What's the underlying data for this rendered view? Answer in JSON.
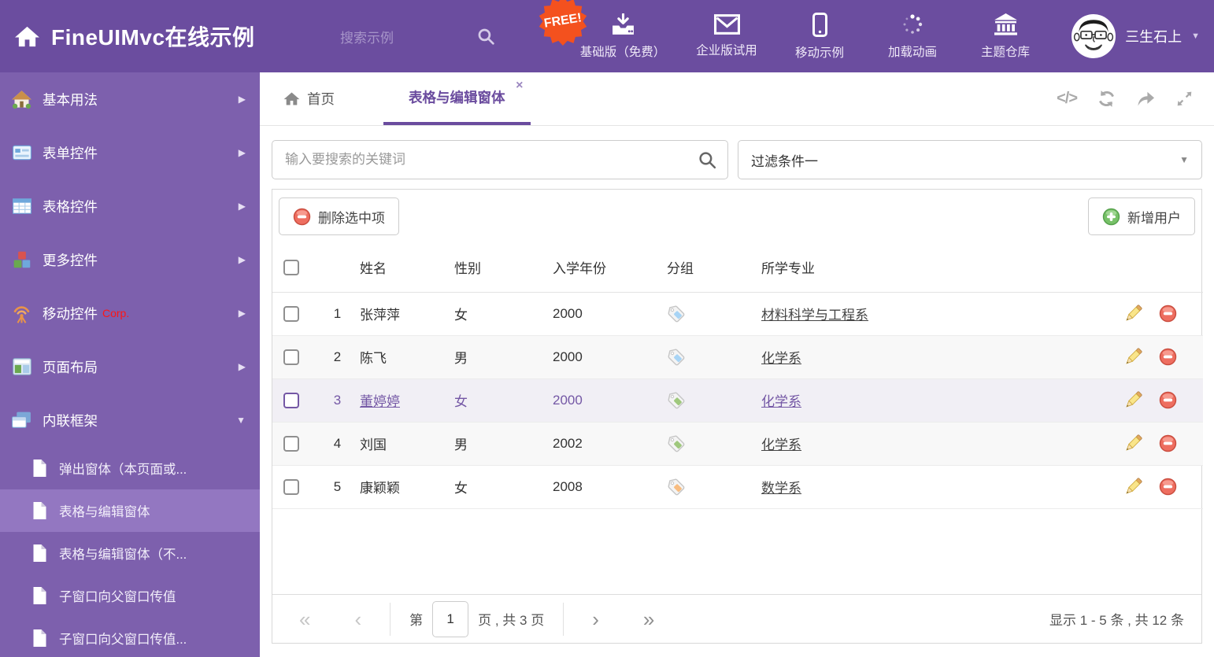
{
  "colors": {
    "header_bg": "#6b4d9f",
    "sidebar_bg": "#7d60ad",
    "sidebar_selected_bg": "#9377c1",
    "accent": "#6a4b9e",
    "free_badge": "#f4511e",
    "selected_row_bg": "#f1eff5",
    "selected_row_text": "#7457a5",
    "tag_blue": "#a8d4f5",
    "tag_green": "#9fc87d",
    "tag_orange": "#f8bc80"
  },
  "header": {
    "title": "FineUIMvc在线示例",
    "search_placeholder": "搜索示例",
    "free_badge": "FREE!",
    "nav_items": [
      {
        "id": "basic",
        "icon": "download-icon",
        "label": "基础版（免费）"
      },
      {
        "id": "enterprise",
        "icon": "envelope-icon",
        "label": "企业版试用"
      },
      {
        "id": "mobile",
        "icon": "mobile-icon",
        "label": "移动示例"
      },
      {
        "id": "loading",
        "icon": "spinner-icon",
        "label": "加载动画"
      },
      {
        "id": "themes",
        "icon": "bank-icon",
        "label": "主题仓库"
      }
    ],
    "user_name": "三生石上"
  },
  "sidebar": {
    "items": [
      {
        "id": "basic-usage",
        "icon": "home-color-icon",
        "label": "基本用法",
        "arrow": "right"
      },
      {
        "id": "form-controls",
        "icon": "form-icon",
        "label": "表单控件",
        "arrow": "right"
      },
      {
        "id": "grid-controls",
        "icon": "table-icon",
        "label": "表格控件",
        "arrow": "right"
      },
      {
        "id": "more-controls",
        "icon": "cubes-icon",
        "label": "更多控件",
        "arrow": "right"
      },
      {
        "id": "mobile-controls",
        "icon": "antenna-icon",
        "label": "移动控件",
        "badge": "Corp.",
        "arrow": "right"
      },
      {
        "id": "page-layout",
        "icon": "layout-icon",
        "label": "页面布局",
        "arrow": "right"
      },
      {
        "id": "inline-frame",
        "icon": "frames-icon",
        "label": "内联框架",
        "arrow": "down",
        "expanded": true,
        "children": [
          {
            "label": "弹出窗体（本页面或...",
            "selected": false
          },
          {
            "label": "表格与编辑窗体",
            "selected": true
          },
          {
            "label": "表格与编辑窗体（不...",
            "selected": false
          },
          {
            "label": "子窗口向父窗口传值",
            "selected": false
          },
          {
            "label": "子窗口向父窗口传值...",
            "selected": false
          }
        ]
      }
    ]
  },
  "tabs": [
    {
      "label": "首页"
    },
    {
      "label": "表格与编辑窗体",
      "active": true,
      "close": "×"
    }
  ],
  "tab_tools": [
    "code-icon",
    "refresh-icon",
    "share-icon",
    "expand-icon"
  ],
  "filter_bar": {
    "search_placeholder": "输入要搜索的关键词",
    "filter_value": "过滤条件一"
  },
  "toolbar": {
    "delete_label": "删除选中项",
    "add_label": "新增用户"
  },
  "table": {
    "columns": [
      "姓名",
      "性别",
      "入学年份",
      "分组",
      "所学专业"
    ],
    "rows": [
      {
        "num": "1",
        "name": "张萍萍",
        "gender": "女",
        "year": "2000",
        "tag": "blue",
        "major": "材料科学与工程系",
        "selected": false
      },
      {
        "num": "2",
        "name": "陈飞",
        "gender": "男",
        "year": "2000",
        "tag": "blue",
        "major": "化学系",
        "selected": false
      },
      {
        "num": "3",
        "name": "董婷婷",
        "gender": "女",
        "year": "2000",
        "tag": "green",
        "major": "化学系",
        "selected": true
      },
      {
        "num": "4",
        "name": "刘国",
        "gender": "男",
        "year": "2002",
        "tag": "green",
        "major": "化学系",
        "selected": false
      },
      {
        "num": "5",
        "name": "康颖颖",
        "gender": "女",
        "year": "2008",
        "tag": "orange",
        "major": "数学系",
        "selected": false
      }
    ]
  },
  "pagination": {
    "first": "«",
    "prev": "‹",
    "page_prefix": "第",
    "page_value": "1",
    "page_suffix": "页 , 共 3 页",
    "next": "›",
    "last": "»",
    "summary": "显示 1 - 5 条 , 共 12 条"
  }
}
